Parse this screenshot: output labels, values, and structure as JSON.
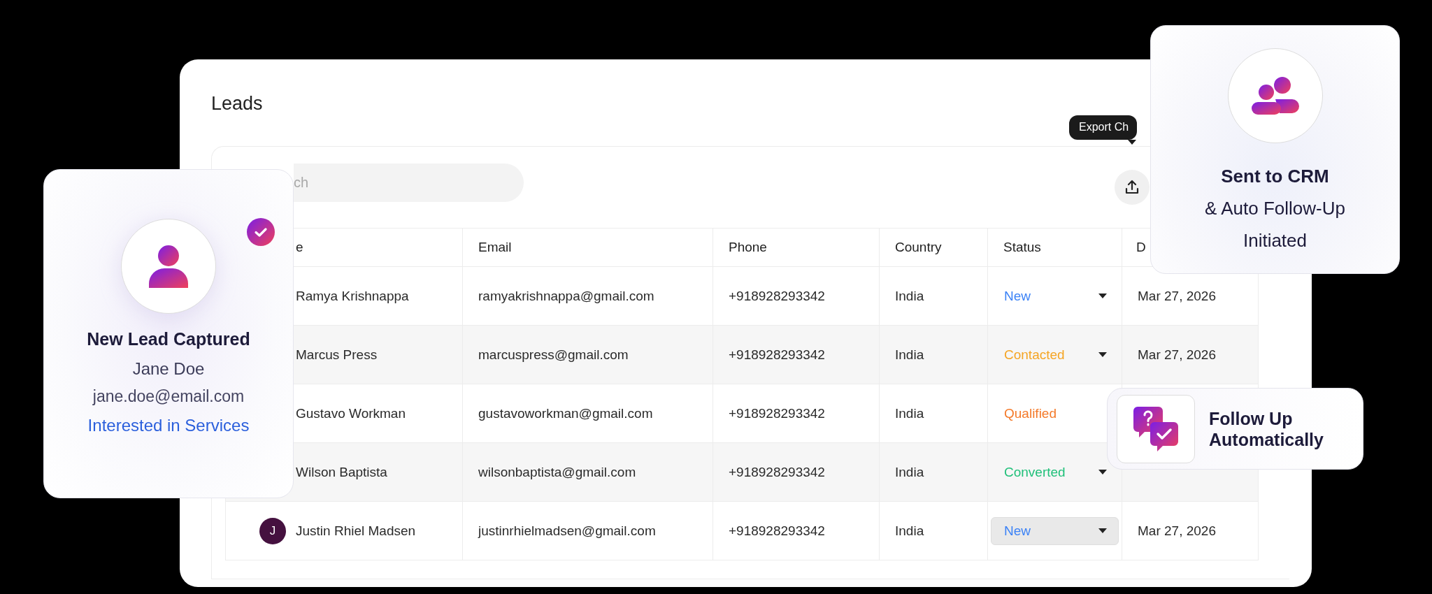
{
  "panel": {
    "title": "Leads",
    "search": {
      "placeholder": "ch"
    },
    "export_tooltip": "Export Ch"
  },
  "table": {
    "columns": [
      "e",
      "Email",
      "Phone",
      "Country",
      "Status",
      "D"
    ],
    "rows": [
      {
        "name": "Ramya Krishnappa",
        "email": "ramyakrishnappa@gmail.com",
        "phone": "+918928293342",
        "country": "India",
        "status": {
          "label": "New",
          "color": "#3b82f6",
          "focused": false,
          "caret": true
        },
        "date": "Mar 27, 2026"
      },
      {
        "name": "Marcus Press",
        "email": "marcuspress@gmail.com",
        "phone": "+918928293342",
        "country": "India",
        "status": {
          "label": "Contacted",
          "color": "#f5a524",
          "focused": false,
          "caret": true
        },
        "date": "Mar 27, 2026"
      },
      {
        "name": "Gustavo Workman",
        "email": "gustavoworkman@gmail.com",
        "phone": "+918928293342",
        "country": "India",
        "status": {
          "label": "Qualified",
          "color": "#f47a2a",
          "focused": false,
          "caret": false
        }
      },
      {
        "name": "Wilson Baptista",
        "email": "wilsonbaptista@gmail.com",
        "phone": "+918928293342",
        "country": "India",
        "status": {
          "label": "Converted",
          "color": "#21c07a",
          "focused": false,
          "caret": true
        }
      },
      {
        "name": "Justin Rhiel Madsen",
        "email": "justinrhielmadsen@gmail.com",
        "phone": "+918928293342",
        "country": "India",
        "avatar": {
          "initial": "J",
          "color": "#45113f"
        },
        "status": {
          "label": "New",
          "color": "#3b82f6",
          "focused": true,
          "caret": true
        },
        "date": "Mar 27, 2026"
      }
    ]
  },
  "lead_card": {
    "title": "New Lead Captured",
    "name": "Jane Doe",
    "email": "jane.doe@email.com",
    "note": "Interested in Services",
    "verified": true
  },
  "crm_card": {
    "lines": [
      "Sent to CRM",
      "& Auto Follow-Up",
      "Initiated"
    ]
  },
  "followup_card": {
    "lines": [
      "Follow Up",
      "Automatically"
    ]
  }
}
